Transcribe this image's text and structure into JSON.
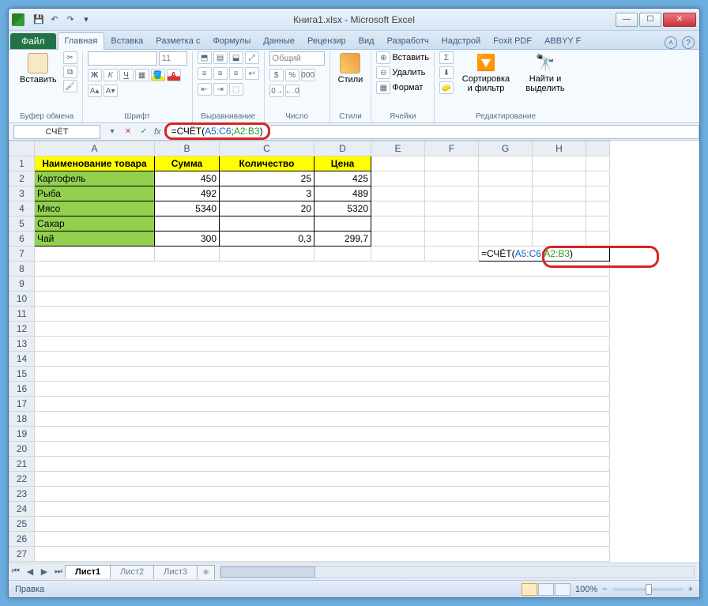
{
  "window": {
    "title": "Книга1.xlsx - Microsoft Excel"
  },
  "tabs": {
    "file": "Файл",
    "items": [
      "Главная",
      "Вставка",
      "Разметка с",
      "Формулы",
      "Данные",
      "Рецензир",
      "Вид",
      "Разработч",
      "Надстрой",
      "Foxit PDF",
      "ABBYY F"
    ],
    "activeIndex": 0
  },
  "ribbon": {
    "clipboard": {
      "label": "Буфер обмена",
      "paste": "Вставить"
    },
    "font": {
      "label": "Шрифт",
      "fontName": "",
      "fontSize": "11"
    },
    "alignment": {
      "label": "Выравнивание"
    },
    "number": {
      "label": "Число",
      "format": "Общий"
    },
    "styles": {
      "label": "Стили",
      "btn": "Стили"
    },
    "cells": {
      "label": "Ячейки",
      "ins": "Вставить",
      "del": "Удалить",
      "fmt": "Формат"
    },
    "editing": {
      "label": "Редактирование",
      "sort": "Сортировка и фильтр",
      "find": "Найти и выделить"
    }
  },
  "namebox": "СЧЁТ",
  "formula": {
    "prefix": "=СЧЁТ(",
    "r1": "A5:C6",
    "sep": ";",
    "r2": "A2:B3",
    "suf": ")"
  },
  "headers": [
    "Наименование товара",
    "Сумма",
    "Количество",
    "Цена"
  ],
  "rows": [
    {
      "name": "Картофель",
      "b": "450",
      "c": "25",
      "d": "425"
    },
    {
      "name": "Рыба",
      "b": "492",
      "c": "3",
      "d": "489"
    },
    {
      "name": "Мясо",
      "b": "5340",
      "c": "20",
      "d": "5320"
    },
    {
      "name": "Сахар",
      "b": "",
      "c": "",
      "d": ""
    },
    {
      "name": "Чай",
      "b": "300",
      "c": "0,3",
      "d": "299,7"
    }
  ],
  "columnLetters": [
    "A",
    "B",
    "C",
    "D",
    "E",
    "F",
    "G",
    "H"
  ],
  "sheets": [
    "Лист1",
    "Лист2",
    "Лист3"
  ],
  "status": "Правка",
  "zoom": "100%"
}
